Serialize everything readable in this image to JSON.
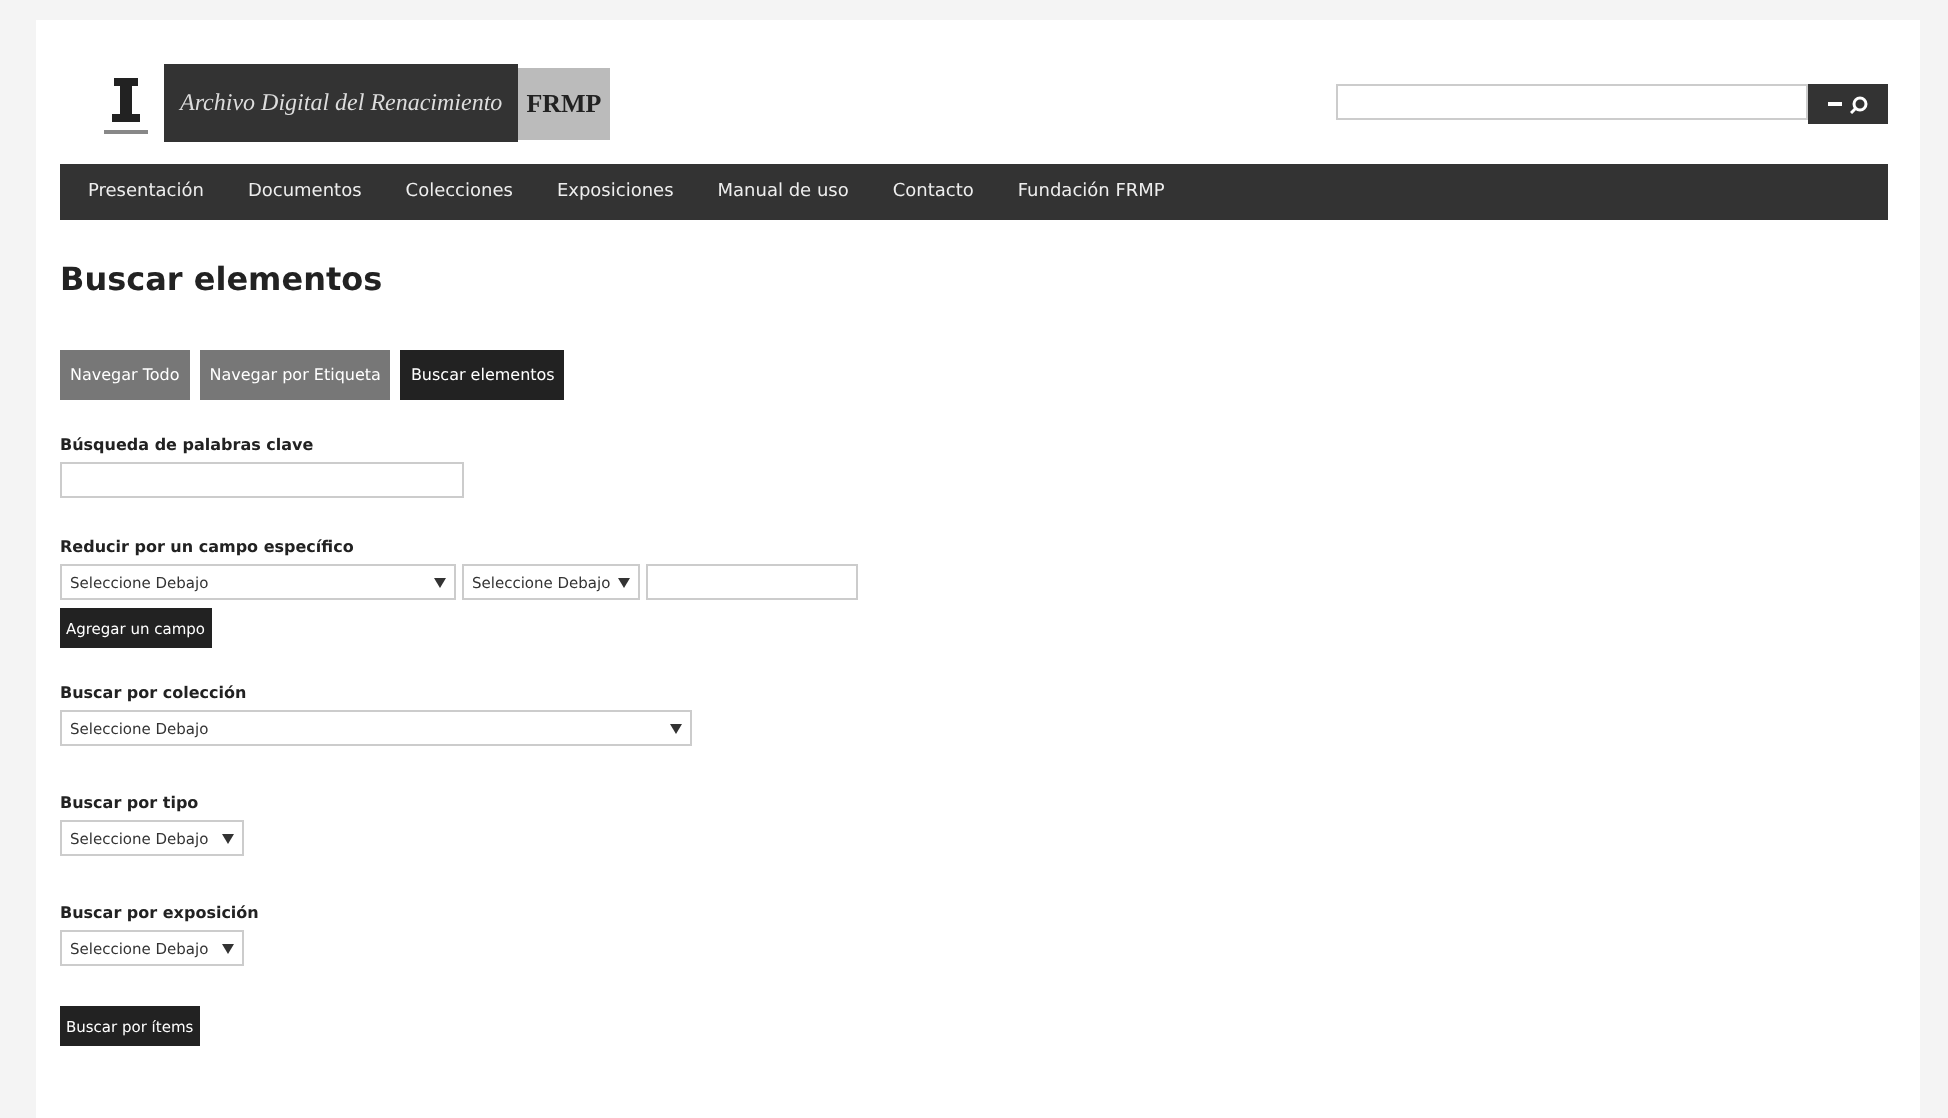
{
  "header": {
    "logo_title": "Archivo Digital del Renacimiento",
    "logo_badge": "FRMP"
  },
  "nav": [
    {
      "label": "Presentación"
    },
    {
      "label": "Documentos"
    },
    {
      "label": "Colecciones"
    },
    {
      "label": "Exposiciones"
    },
    {
      "label": "Manual de uso"
    },
    {
      "label": "Contacto"
    },
    {
      "label": "Fundación FRMP"
    }
  ],
  "page_title": "Buscar elementos",
  "tabs": [
    {
      "label": "Navegar Todo",
      "selected": false
    },
    {
      "label": "Navegar por Etiqueta",
      "selected": false
    },
    {
      "label": "Buscar elementos",
      "selected": true
    }
  ],
  "keyword": {
    "label": "Búsqueda de palabras clave"
  },
  "field_filter": {
    "label": "Reducir por un campo específico",
    "field_select": "Seleccione Debajo",
    "operator_select": "Seleccione Debajo",
    "add_button": "Agregar un campo"
  },
  "filters": [
    {
      "label": "Buscar por colección",
      "value": "Seleccione Debajo",
      "wide": true
    },
    {
      "label": "Buscar por tipo",
      "value": "Seleccione Debajo",
      "wide": false
    },
    {
      "label": "Buscar por exposición",
      "value": "Seleccione Debajo",
      "wide": false
    }
  ],
  "submit": "Buscar por ítems"
}
